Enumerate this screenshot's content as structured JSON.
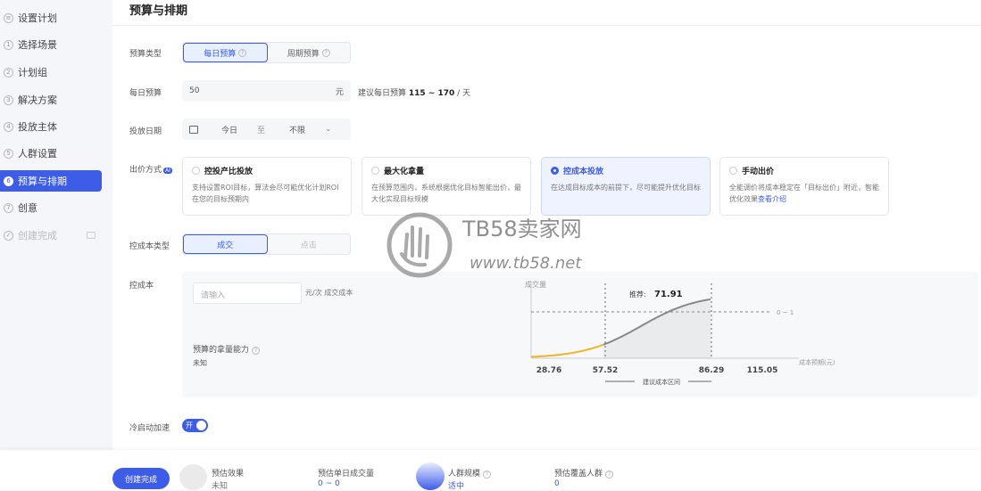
{
  "sidebar": {
    "items": [
      {
        "num": "",
        "label": "设置计划"
      },
      {
        "num": "1",
        "label": "选择场景"
      },
      {
        "num": "2",
        "label": "计划组"
      },
      {
        "num": "3",
        "label": "解决方案"
      },
      {
        "num": "4",
        "label": "投放主体"
      },
      {
        "num": "5",
        "label": "人群设置"
      },
      {
        "num": "6",
        "label": "预算与排期"
      },
      {
        "num": "7",
        "label": "创意"
      },
      {
        "num": "",
        "label": "创建完成"
      }
    ]
  },
  "section_title": "预算与排期",
  "budget_type": {
    "label": "预算类型",
    "options": [
      "每日预算",
      "周期预算"
    ]
  },
  "daily_budget": {
    "label": "每日预算",
    "value": "50",
    "unit": "元",
    "hint_prefix": "建议每日预算",
    "hint_range": "115 ~ 170",
    "hint_suffix": "/ 天"
  },
  "dates": {
    "label": "投放日期",
    "start": "今日",
    "sep": "至",
    "end": "不限"
  },
  "bid_method": {
    "label": "出价方式",
    "ai": "AI",
    "cards": [
      {
        "title": "控投产比投放",
        "desc": "支持设置ROI目标，算法会尽可能优化计划ROI在您的目标预期内"
      },
      {
        "title": "最大化拿量",
        "desc": "在预算范围内，系统根据优化目标智能出价，最大化实现目标规模"
      },
      {
        "title": "控成本投放",
        "desc": "在达成目标成本的前提下，尽可能提升优化目标"
      },
      {
        "title": "手动出价",
        "desc": "全能调价将成本稳定在「目标出价」附近，智能优化效果",
        "link": "查看介绍"
      }
    ]
  },
  "cost_type": {
    "label": "控成本类型",
    "options": [
      "成交",
      "点击"
    ]
  },
  "cost": {
    "label": "控成本",
    "placeholder": "请输入",
    "unit": "元/次 成交成本",
    "capability_label": "预算的拿量能力",
    "capability_value": "未知"
  },
  "chart_data": {
    "type": "line",
    "ylabel": "成交量",
    "xlabel": "成本预期(元)",
    "x_ticks": [
      "28.76",
      "57.52",
      "86.29",
      "115.05"
    ],
    "recommend_label": "推荐:",
    "recommend_value": "71.91",
    "ref_label": "0 ~ 1",
    "range_label": "建议成本区间"
  },
  "cold_start": {
    "label": "冷启动加速",
    "toggle": "开"
  },
  "footer": {
    "create": "创建完成",
    "est_effect_label": "预估效果",
    "est_effect_value": "未知",
    "est_deals_label": "预估单日成交量",
    "est_deals_value": "0 ~ 0",
    "crowd_label": "人群规模",
    "crowd_value": "适中",
    "coverage_label": "预估覆盖人群",
    "coverage_value": "0"
  },
  "watermark": {
    "text": "TB58卖家网",
    "url": "www.tb58.net"
  },
  "colors": {
    "accent": "#3d5ce8",
    "curve_low": "#f0b429",
    "curve_high": "#888888"
  }
}
